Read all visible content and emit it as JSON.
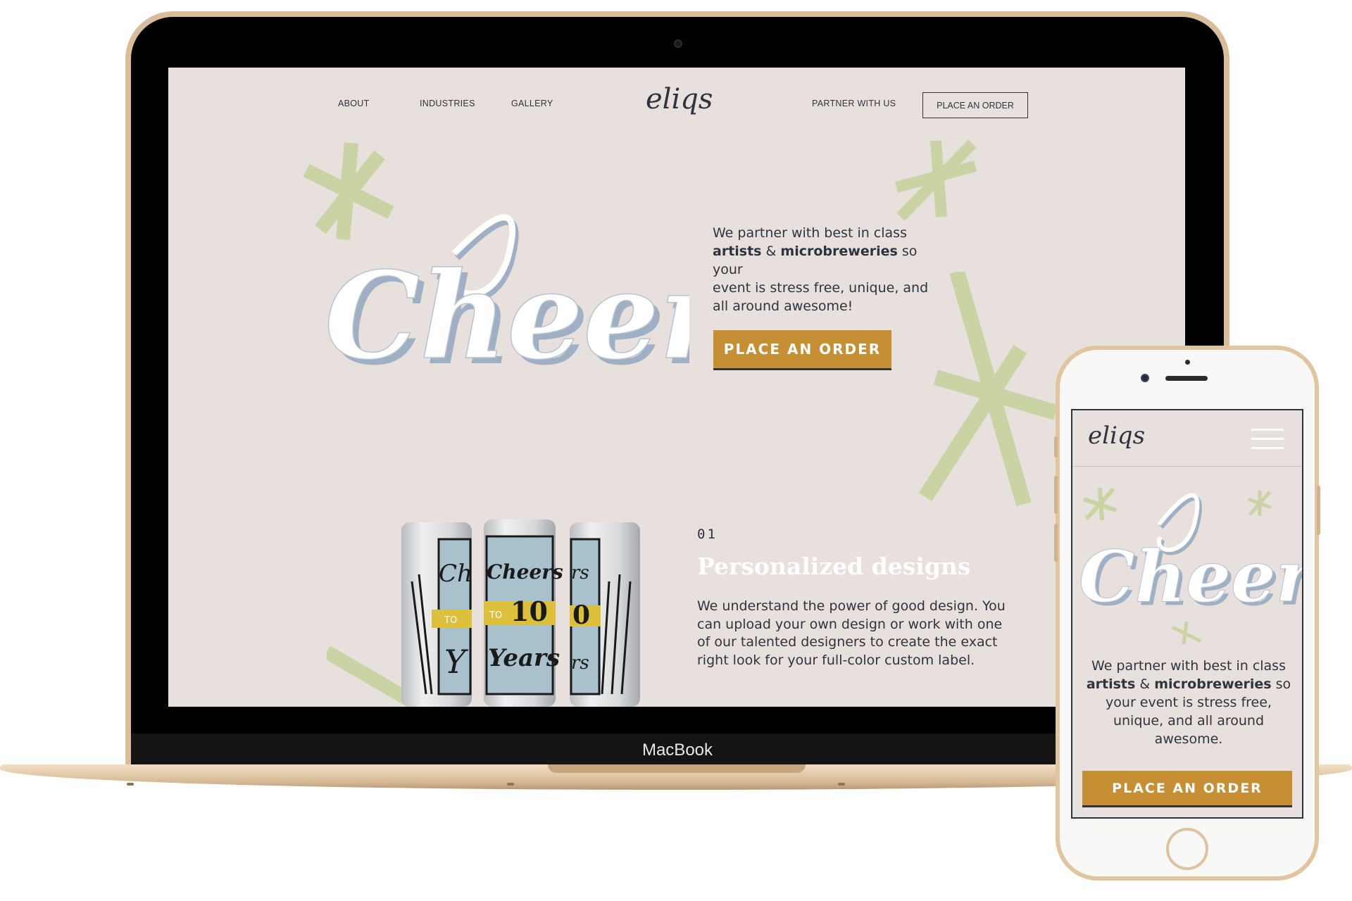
{
  "desktop": {
    "device_label": "MacBook",
    "nav": {
      "about": "ABOUT",
      "industries": "INDUSTRIES",
      "gallery": "GALLERY",
      "logo": "eliqs",
      "partner": "PARTNER WITH US",
      "order": "PLACE AN ORDER"
    },
    "hero": {
      "lettering": "Cheers!",
      "line1": "We partner with best in class",
      "bold1": "artists",
      "amp": " & ",
      "bold2": "microbreweries",
      "line2_rest": " so your",
      "line3": "event is stress free, unique, and",
      "line4": "all around awesome!",
      "cta": "PLACE AN ORDER"
    },
    "section": {
      "number": "01",
      "title": "Personalized designs",
      "text": "We understand the power of good design. You can upload your own design or work with one of our talented designers to create the exact right look for your full-color custom label.",
      "cans": {
        "left": [
          "Ch",
          "TO",
          "Y"
        ],
        "center": [
          "Cheers",
          "TO",
          "10",
          "Years"
        ],
        "right": [
          "rs",
          "0",
          "rs"
        ]
      }
    }
  },
  "mobile": {
    "logo": "eliqs",
    "hero": {
      "lettering": "Cheers!",
      "line1": "We partner with best in class",
      "bold1": "artists",
      "amp": " & ",
      "bold2": "microbreweries",
      "line2_rest": " so",
      "line3": "your event is stress free,",
      "line4": "unique, and all around",
      "line5": "awesome.",
      "cta": "PLACE AN ORDER"
    }
  },
  "colors": {
    "background": "#e7e0dc",
    "accent": "#c78f33",
    "ink": "#2d3440",
    "asterisk": "#c9d3a3",
    "device_gold": "#d9bd9a"
  },
  "icons": [
    "asterisk-decoration-icon",
    "hamburger-menu-icon"
  ]
}
